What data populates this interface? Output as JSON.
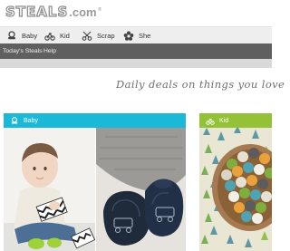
{
  "brand": {
    "name": "STEALS",
    "suffix": ".com",
    "mark": "®"
  },
  "categories": [
    {
      "label": "Baby",
      "icon": "pacifier-icon"
    },
    {
      "label": "Kid",
      "icon": "tricycle-icon"
    },
    {
      "label": "Scrap",
      "icon": "scissors-icon"
    },
    {
      "label": "She",
      "icon": "flower-icon"
    }
  ],
  "subnav": [
    {
      "label": "Today's Steals"
    },
    {
      "label": "Help"
    }
  ],
  "tagline": "Daily deals on things you love",
  "sections": {
    "baby": {
      "label": "Baby",
      "color": "#1cb8d7"
    },
    "kid": {
      "label": "Kid",
      "color": "#93c138"
    }
  }
}
